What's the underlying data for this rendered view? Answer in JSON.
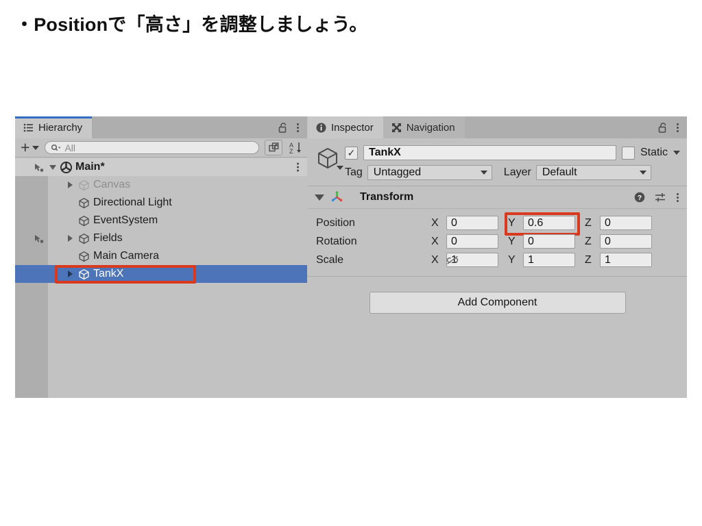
{
  "slide": {
    "title": "・Positionで「高さ」を調整しましょう。"
  },
  "colors": {
    "annotation_red": "#d9391d",
    "selection_blue": "#4d74b8",
    "tab_accent_blue": "#2f6ec4",
    "panel_bg": "#c2c2c2"
  },
  "hierarchy": {
    "tab": {
      "label": "Hierarchy",
      "icon": "list-icon",
      "active": true
    },
    "lock_icon": "unlocked-padlock-icon",
    "menu_icon": "kebab-menu-icon",
    "toolbar": {
      "add_label": "+",
      "add_dropdown_icon": "chevron-down-icon",
      "search_placeholder": "All",
      "search_icon": "search-dropdown-icon",
      "select_visibility_icon": "scene-visibility-icon",
      "sort_icon": "alphabetical-sort-icon",
      "sort_label": "AZ"
    },
    "scene_row": {
      "label": "Main*",
      "icon": "unity-scene-icon",
      "expanded": true,
      "menu_icon": "kebab-menu-icon",
      "visibility_icon": "hand-pointer-icon"
    },
    "items": [
      {
        "label": "Canvas",
        "icon": "gameobject-cube-icon",
        "expandable": true,
        "dimmed": true,
        "selected": false,
        "visibility_icon": ""
      },
      {
        "label": "Directional Light",
        "icon": "gameobject-cube-icon",
        "expandable": false,
        "dimmed": false,
        "selected": false,
        "visibility_icon": ""
      },
      {
        "label": "EventSystem",
        "icon": "gameobject-cube-icon",
        "expandable": false,
        "dimmed": false,
        "selected": false,
        "visibility_icon": ""
      },
      {
        "label": "Fields",
        "icon": "gameobject-cube-icon",
        "expandable": true,
        "dimmed": false,
        "selected": false,
        "visibility_icon": "hand-pointer-icon"
      },
      {
        "label": "Main Camera",
        "icon": "gameobject-cube-icon",
        "expandable": false,
        "dimmed": false,
        "selected": false,
        "visibility_icon": ""
      },
      {
        "label": "TankX",
        "icon": "gameobject-cube-icon",
        "expandable": true,
        "dimmed": false,
        "selected": true,
        "visibility_icon": ""
      }
    ]
  },
  "inspector": {
    "tabs": [
      {
        "label": "Inspector",
        "icon": "info-circle-icon",
        "active": true
      },
      {
        "label": "Navigation",
        "icon": "expand-arrows-icon",
        "active": false
      }
    ],
    "lock_icon": "unlocked-padlock-icon",
    "menu_icon": "kebab-menu-icon",
    "object": {
      "icon": "gameobject-cube-icon",
      "enabled": true,
      "enabled_check": "✓",
      "name": "TankX",
      "static_label": "Static",
      "static_checked": false,
      "static_dropdown_icon": "chevron-down-icon",
      "tag_label": "Tag",
      "tag_value": "Untagged",
      "layer_label": "Layer",
      "layer_value": "Default"
    },
    "transform": {
      "title": "Transform",
      "icon": "transform-axes-icon",
      "expanded": true,
      "help_icon": "help-question-icon",
      "preset_icon": "preset-sliders-icon",
      "menu_icon": "kebab-menu-icon",
      "rows": [
        {
          "label": "Position",
          "link_icon": "",
          "axes": [
            {
              "letter": "X",
              "value": "0",
              "highlighted": false
            },
            {
              "letter": "Y",
              "value": "0.6",
              "highlighted": true
            },
            {
              "letter": "Z",
              "value": "0",
              "highlighted": false
            }
          ]
        },
        {
          "label": "Rotation",
          "link_icon": "",
          "axes": [
            {
              "letter": "X",
              "value": "0",
              "highlighted": false
            },
            {
              "letter": "Y",
              "value": "0",
              "highlighted": false
            },
            {
              "letter": "Z",
              "value": "0",
              "highlighted": false
            }
          ]
        },
        {
          "label": "Scale",
          "link_icon": "broken-link-icon",
          "axes": [
            {
              "letter": "X",
              "value": "1",
              "highlighted": false
            },
            {
              "letter": "Y",
              "value": "1",
              "highlighted": false
            },
            {
              "letter": "Z",
              "value": "1",
              "highlighted": false
            }
          ]
        }
      ]
    },
    "add_component_label": "Add Component"
  }
}
